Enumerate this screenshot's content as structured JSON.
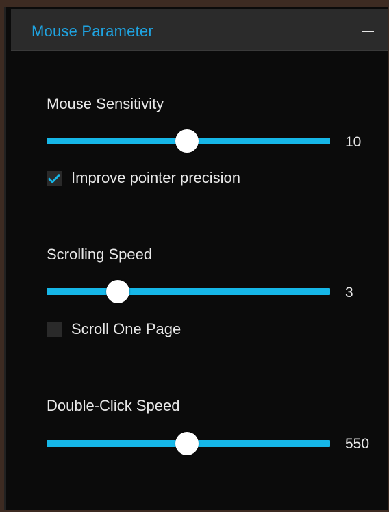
{
  "panel": {
    "title": "Mouse Parameter",
    "collapse_icon": "minus-icon"
  },
  "sensitivity": {
    "label": "Mouse Sensitivity",
    "value": "10",
    "fraction": 0.495,
    "checkbox": {
      "label": "Improve pointer precision",
      "checked": true
    }
  },
  "scrolling": {
    "label": "Scrolling Speed",
    "value": "3",
    "fraction": 0.25,
    "checkbox": {
      "label": "Scroll One Page",
      "checked": false
    }
  },
  "doubleclick": {
    "label": "Double-Click Speed",
    "value": "550",
    "fraction": 0.495
  },
  "colors": {
    "accent": "#16b7e8",
    "title": "#1fa3e0",
    "background": "#0b0b0b",
    "header": "#2b2b2b",
    "text": "#e8e8e8"
  }
}
